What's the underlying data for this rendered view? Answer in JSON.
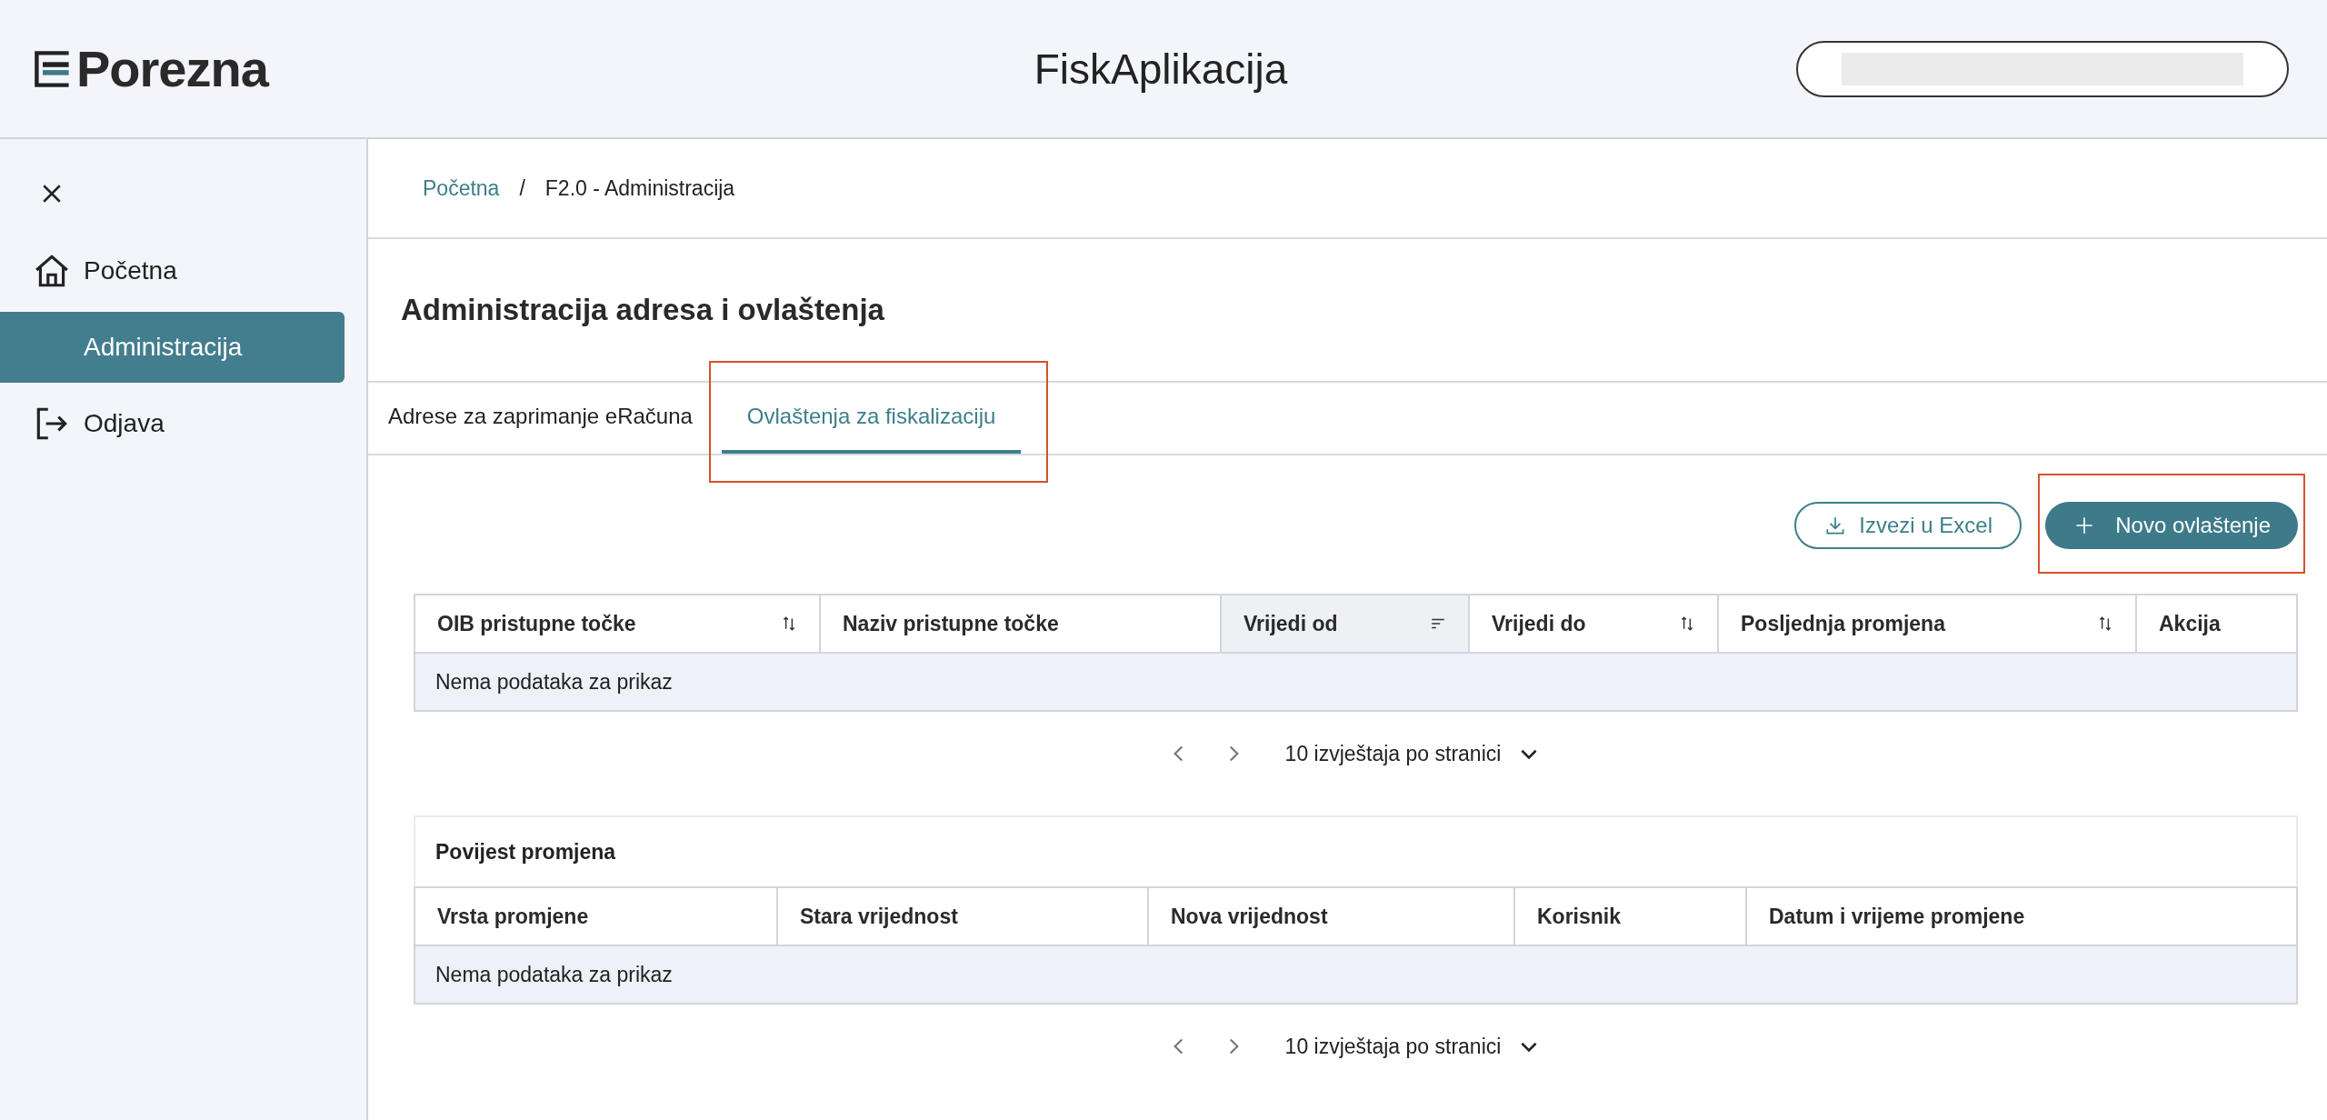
{
  "header": {
    "logo": "Porezna",
    "title": "FiskAplikacija",
    "user_pill": {
      "redacted": true
    }
  },
  "sidebar": {
    "items": [
      {
        "label": "Početna",
        "kind": "home",
        "selected": false
      },
      {
        "label": "Administracija",
        "kind": "plain",
        "selected": true
      },
      {
        "label": "Odjava",
        "kind": "logout",
        "selected": false
      }
    ]
  },
  "breadcrumb": [
    {
      "label": "Početna",
      "kind": "link"
    },
    {
      "label": "/",
      "kind": "separator"
    },
    {
      "label": "F2.0 - Administracija",
      "kind": "current"
    }
  ],
  "page_title": "Administracija adresa i ovlaštenja",
  "tabs": [
    {
      "label": "Adrese za zaprimanje eRačuna",
      "selected": false,
      "highlighted": false
    },
    {
      "label": "Ovlaštenja za fiskalizaciju",
      "selected": true,
      "highlighted": true
    }
  ],
  "actions": [
    {
      "label": "Izvezi u Excel",
      "kind": "outline",
      "highlighted": false
    },
    {
      "label": "Novo ovlaštenje",
      "kind": "primary",
      "highlighted": true
    }
  ],
  "table": {
    "columns": [
      {
        "label": "OIB pristupne točke",
        "kind": "sortable"
      },
      {
        "label": "Naziv pristupne točke",
        "kind": "plain"
      },
      {
        "label": "Vrijedi od",
        "kind": "sorted"
      },
      {
        "label": "Vrijedi do",
        "kind": "sortable"
      },
      {
        "label": "Posljednja promjena",
        "kind": "sortable"
      },
      {
        "label": "Akcija",
        "kind": "plain"
      }
    ],
    "empty_text": "Nema podataka za prikaz",
    "pagination": {
      "page_size": "10 izvještaja po stranici"
    }
  },
  "history": {
    "title": "Povijest promjena",
    "columns": [
      {
        "label": "Vrsta promjene"
      },
      {
        "label": "Stara vrijednost"
      },
      {
        "label": "Nova vrijednost"
      },
      {
        "label": "Korisnik"
      },
      {
        "label": "Datum i vrijeme promjene"
      }
    ],
    "empty_text": "Nema podataka za prikaz",
    "pagination": {
      "page_size": "10 izvještaja po stranici"
    }
  }
}
